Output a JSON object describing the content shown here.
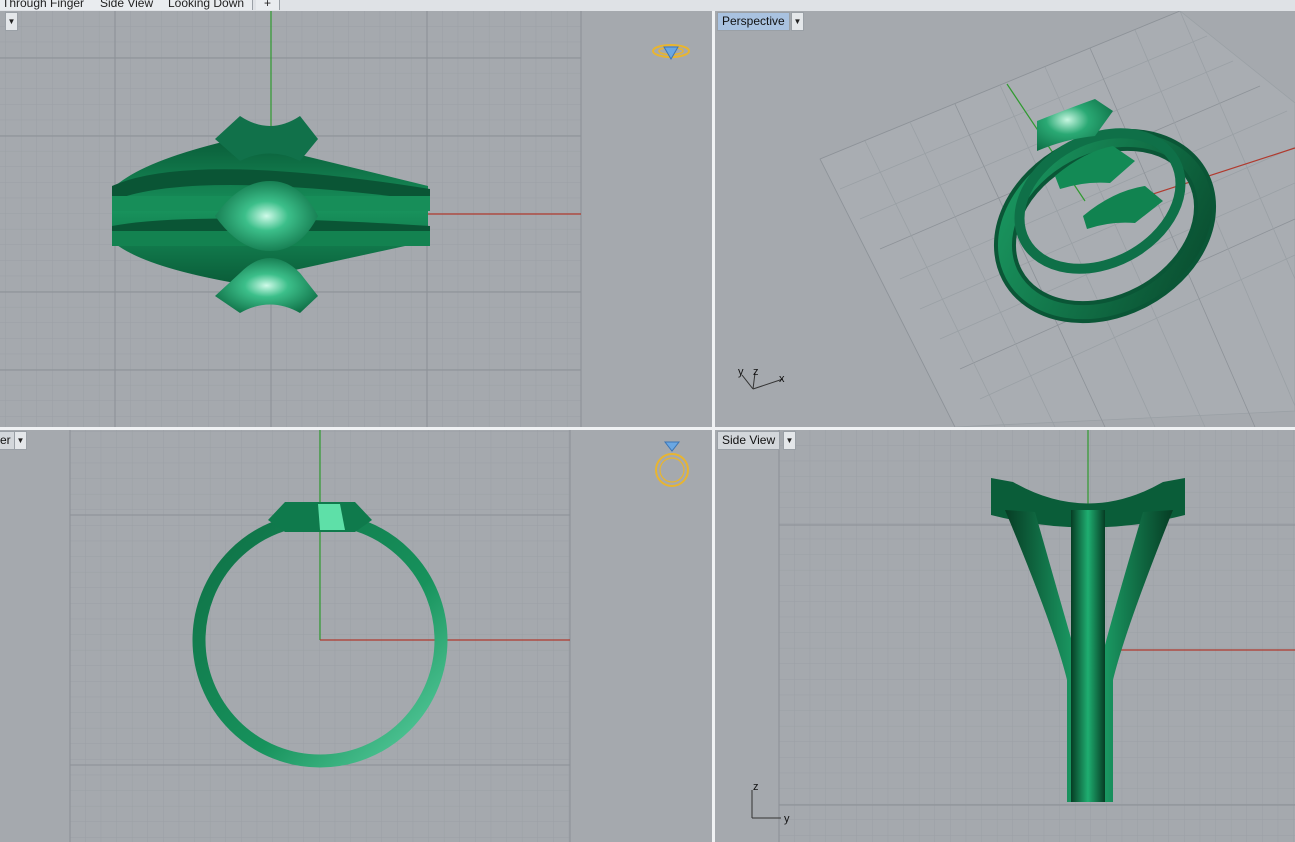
{
  "tabs": [
    {
      "label": "Through Finger"
    },
    {
      "label": "Side View"
    },
    {
      "label": "Looking Down"
    },
    {
      "label": "+"
    }
  ],
  "viewports": {
    "top_left": {
      "label": ""
    },
    "top_right": {
      "label": "Perspective"
    },
    "bottom_left": {
      "label": "er"
    },
    "bottom_right": {
      "label": "Side View"
    }
  },
  "axes": {
    "perspective": {
      "y": "y",
      "z": "z",
      "x": "x"
    },
    "side": {
      "z": "z",
      "y": "y"
    }
  },
  "colors": {
    "background": "#a5a9ae",
    "grid_minor": "#9ba0a5",
    "grid_major": "#8d9298",
    "ring_green": "#0f7a4c",
    "axis_x": "#b03a2e",
    "axis_y": "#2f9a2f",
    "icon_gold": "#e8b530"
  },
  "icons": [
    "dropdown-arrow-icon",
    "ring-thumbnail-icon",
    "gem-ring-icon"
  ]
}
